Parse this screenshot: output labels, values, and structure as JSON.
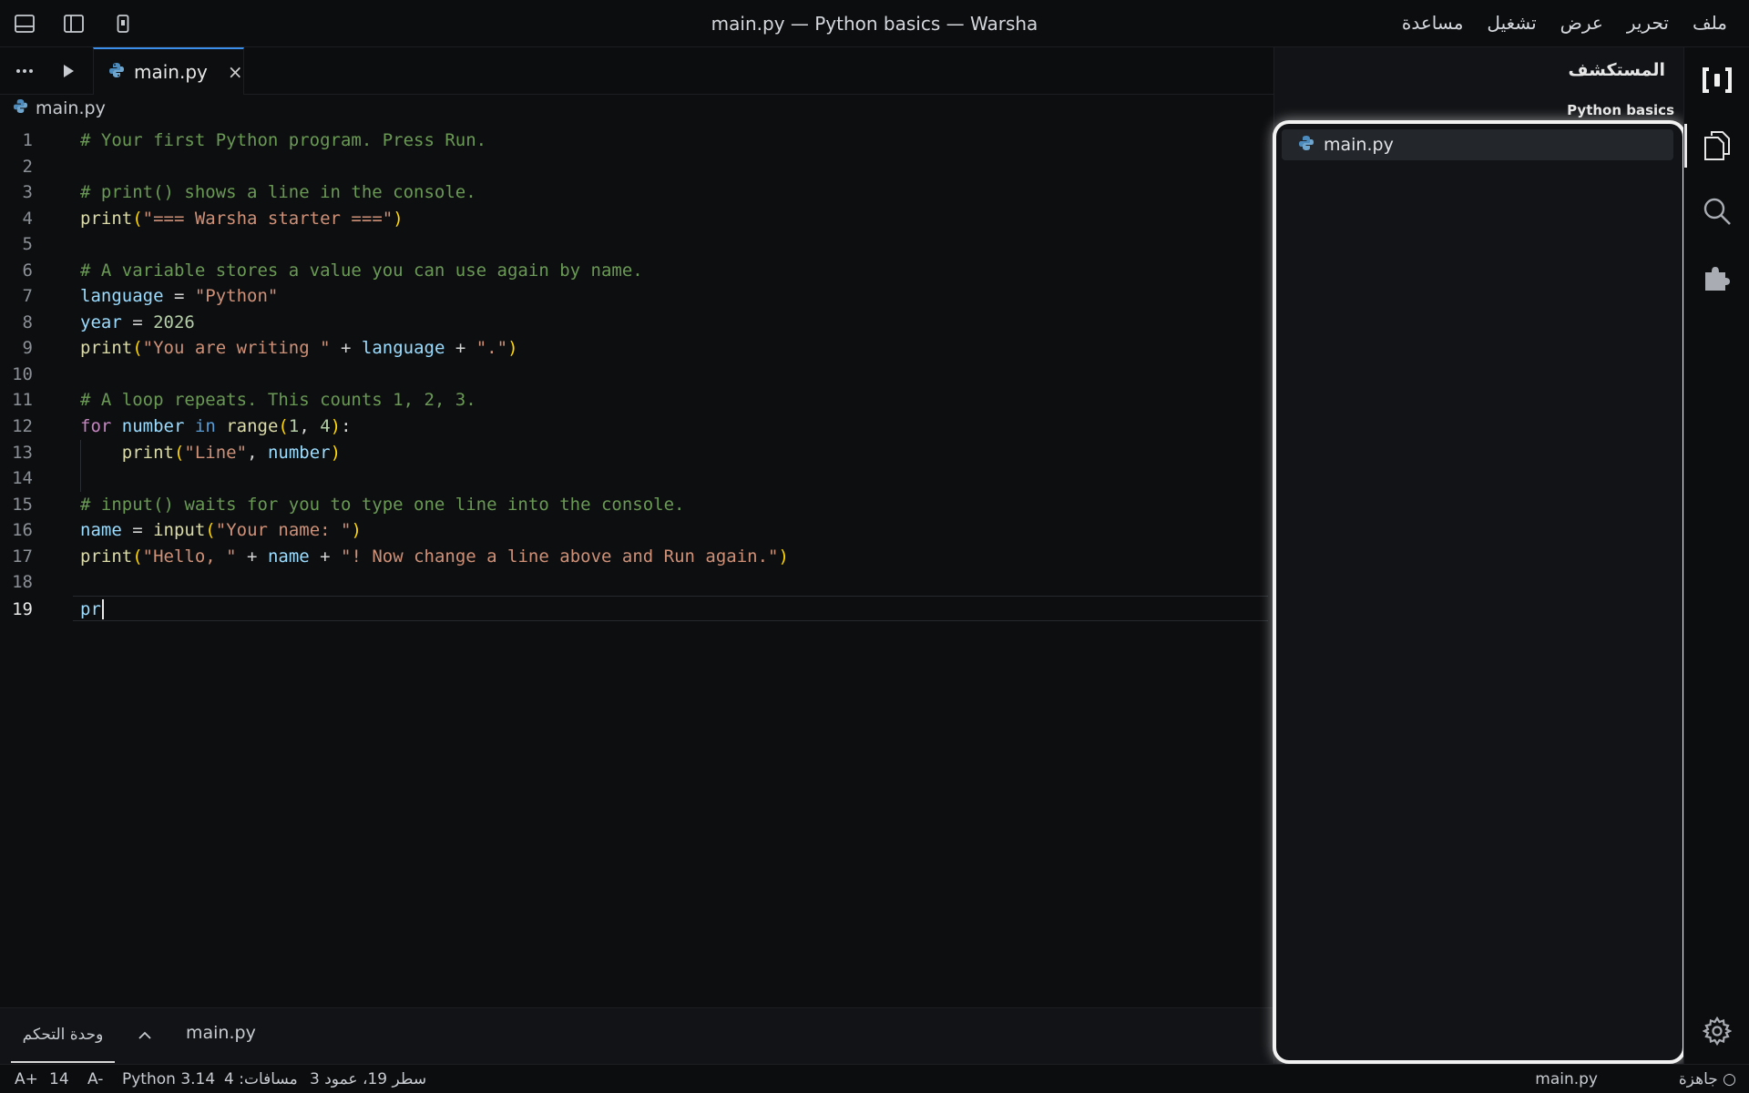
{
  "window": {
    "title": "main.py — Python basics — Warsha"
  },
  "menu": [
    "ملف",
    "تحرير",
    "عرض",
    "تشغيل",
    "مساعدة"
  ],
  "titlebar_icons": [
    "panel-bottom-icon",
    "sidebar-left-icon",
    "mobile-device-icon"
  ],
  "activity_bar": {
    "items": [
      "brand-logo-icon",
      "files-icon",
      "search-icon",
      "extensions-icon"
    ],
    "settings": "gear-icon"
  },
  "explorer": {
    "title": "المستكشف",
    "project": "Python basics",
    "files": [
      {
        "name": "main.py",
        "icon": "python-icon"
      }
    ]
  },
  "editor": {
    "tab": {
      "label": "main.py",
      "close": "×"
    },
    "more_icon": "ellipsis-icon",
    "run_icon": "play-icon",
    "breadcrumb": "main.py",
    "lines": [
      {
        "n": "1",
        "tokens": [
          {
            "t": "# Your first Python program. Press Run.",
            "c": "com"
          }
        ]
      },
      {
        "n": "2",
        "tokens": []
      },
      {
        "n": "3",
        "tokens": [
          {
            "t": "# print() shows a line in the console.",
            "c": "com"
          }
        ]
      },
      {
        "n": "4",
        "tokens": [
          {
            "t": "print",
            "c": "fn"
          },
          {
            "t": "(",
            "c": "pun"
          },
          {
            "t": "\"=== Warsha starter ===\"",
            "c": "str"
          },
          {
            "t": ")",
            "c": "pun"
          }
        ]
      },
      {
        "n": "5",
        "tokens": []
      },
      {
        "n": "6",
        "tokens": [
          {
            "t": "# A variable stores a value you can use again by name.",
            "c": "com"
          }
        ]
      },
      {
        "n": "7",
        "tokens": [
          {
            "t": "language",
            "c": "var"
          },
          {
            "t": " = ",
            "c": "op"
          },
          {
            "t": "\"Python\"",
            "c": "str"
          }
        ]
      },
      {
        "n": "8",
        "tokens": [
          {
            "t": "year",
            "c": "var"
          },
          {
            "t": " = ",
            "c": "op"
          },
          {
            "t": "2026",
            "c": "num"
          }
        ]
      },
      {
        "n": "9",
        "tokens": [
          {
            "t": "print",
            "c": "fn"
          },
          {
            "t": "(",
            "c": "pun"
          },
          {
            "t": "\"You are writing \"",
            "c": "str"
          },
          {
            "t": " + ",
            "c": "op"
          },
          {
            "t": "language",
            "c": "var"
          },
          {
            "t": " + ",
            "c": "op"
          },
          {
            "t": "\".\"",
            "c": "str"
          },
          {
            "t": ")",
            "c": "pun"
          }
        ]
      },
      {
        "n": "10",
        "tokens": []
      },
      {
        "n": "11",
        "tokens": [
          {
            "t": "# A loop repeats. This counts 1, 2, 3.",
            "c": "com"
          }
        ]
      },
      {
        "n": "12",
        "tokens": [
          {
            "t": "for",
            "c": "kw"
          },
          {
            "t": " ",
            "c": "op"
          },
          {
            "t": "number",
            "c": "var"
          },
          {
            "t": " ",
            "c": "op"
          },
          {
            "t": "in",
            "c": "kw2"
          },
          {
            "t": " ",
            "c": "op"
          },
          {
            "t": "range",
            "c": "fn"
          },
          {
            "t": "(",
            "c": "pun"
          },
          {
            "t": "1",
            "c": "num"
          },
          {
            "t": ", ",
            "c": "op"
          },
          {
            "t": "4",
            "c": "num"
          },
          {
            "t": ")",
            "c": "pun"
          },
          {
            "t": ":",
            "c": "op"
          }
        ]
      },
      {
        "n": "13",
        "tokens": [
          {
            "t": "    ",
            "c": "op"
          },
          {
            "t": "print",
            "c": "fn"
          },
          {
            "t": "(",
            "c": "pun"
          },
          {
            "t": "\"Line\"",
            "c": "str"
          },
          {
            "t": ", ",
            "c": "op"
          },
          {
            "t": "number",
            "c": "var"
          },
          {
            "t": ")",
            "c": "pun"
          }
        ]
      },
      {
        "n": "14",
        "tokens": []
      },
      {
        "n": "15",
        "tokens": [
          {
            "t": "# input() waits for you to type one line into the console.",
            "c": "com"
          }
        ]
      },
      {
        "n": "16",
        "tokens": [
          {
            "t": "name",
            "c": "var"
          },
          {
            "t": " = ",
            "c": "op"
          },
          {
            "t": "input",
            "c": "fn"
          },
          {
            "t": "(",
            "c": "pun"
          },
          {
            "t": "\"Your name: \"",
            "c": "str"
          },
          {
            "t": ")",
            "c": "pun"
          }
        ]
      },
      {
        "n": "17",
        "tokens": [
          {
            "t": "print",
            "c": "fn"
          },
          {
            "t": "(",
            "c": "pun"
          },
          {
            "t": "\"Hello, \"",
            "c": "str"
          },
          {
            "t": " + ",
            "c": "op"
          },
          {
            "t": "name",
            "c": "var"
          },
          {
            "t": " + ",
            "c": "op"
          },
          {
            "t": "\"! Now change a line above and Run again.\"",
            "c": "str"
          },
          {
            "t": ")",
            "c": "pun"
          }
        ]
      },
      {
        "n": "18",
        "tokens": []
      },
      {
        "n": "19",
        "tokens": [
          {
            "t": "pr",
            "c": "var"
          }
        ],
        "current": true
      }
    ]
  },
  "panel": {
    "console_tab": "وحدة التحكم",
    "file": "main.py"
  },
  "status": {
    "font_increase": "A+",
    "font_size": "14",
    "font_decrease": "A-",
    "language": "Python 3.14",
    "spaces": "مسافات: 4",
    "position": "سطر 19، عمود 3",
    "file": "main.py",
    "ready": "○ جاهزة"
  },
  "colors": {
    "comment": "#6a9955",
    "function": "#dcdcaa",
    "string": "#ce9178",
    "variable": "#9cdcfe",
    "number": "#b5cea8",
    "keyword": "#c586c0",
    "bracket": "#ffd700"
  }
}
